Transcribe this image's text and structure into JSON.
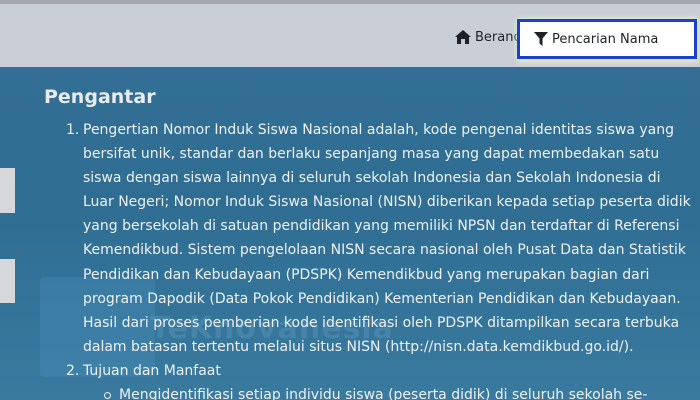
{
  "nav": {
    "home_label": "Beranda",
    "search_label": "Pencarian Nama"
  },
  "content": {
    "heading": "Pengantar",
    "items": [
      {
        "num": "1.",
        "lines": [
          "Pengertian Nomor Induk Siswa Nasional adalah, kode pengenal identitas siswa yang",
          "bersifat unik, standar dan berlaku sepanjang masa yang dapat membedakan satu",
          "siswa dengan siswa lainnya di seluruh sekolah Indonesia dan Sekolah Indonesia di",
          "Luar Negeri; Nomor Induk Siswa Nasional (NISN) diberikan kepada setiap peserta didik",
          "yang bersekolah di satuan pendidikan yang memiliki NPSN dan terdaftar di Referensi",
          "Kemendikbud. Sistem pengelolaan NISN secara nasional oleh Pusat Data dan Statistik",
          "Pendidikan dan Kebudayaan (PDSPK) Kemendikbud yang merupakan bagian dari",
          "program Dapodik (Data Pokok Pendidikan) Kementerian Pendidikan dan Kebudayaan.",
          "Hasil dari proses pemberian kode identifikasi oleh PDSPK ditampilkan secara terbuka",
          "dalam batasan tertentu melalui situs NISN (http://nisn.data.kemdikbud.go.id/)."
        ]
      },
      {
        "num": "2.",
        "lines": [
          "Tujuan dan Manfaat"
        ],
        "sub": [
          "Mengidentifikasi setiap individu siswa (peserta didik) di seluruh sekolah se-"
        ]
      }
    ]
  },
  "icons": {
    "home": "home-icon",
    "filter": "filter-icon"
  },
  "watermark": "TeKnovanesia"
}
